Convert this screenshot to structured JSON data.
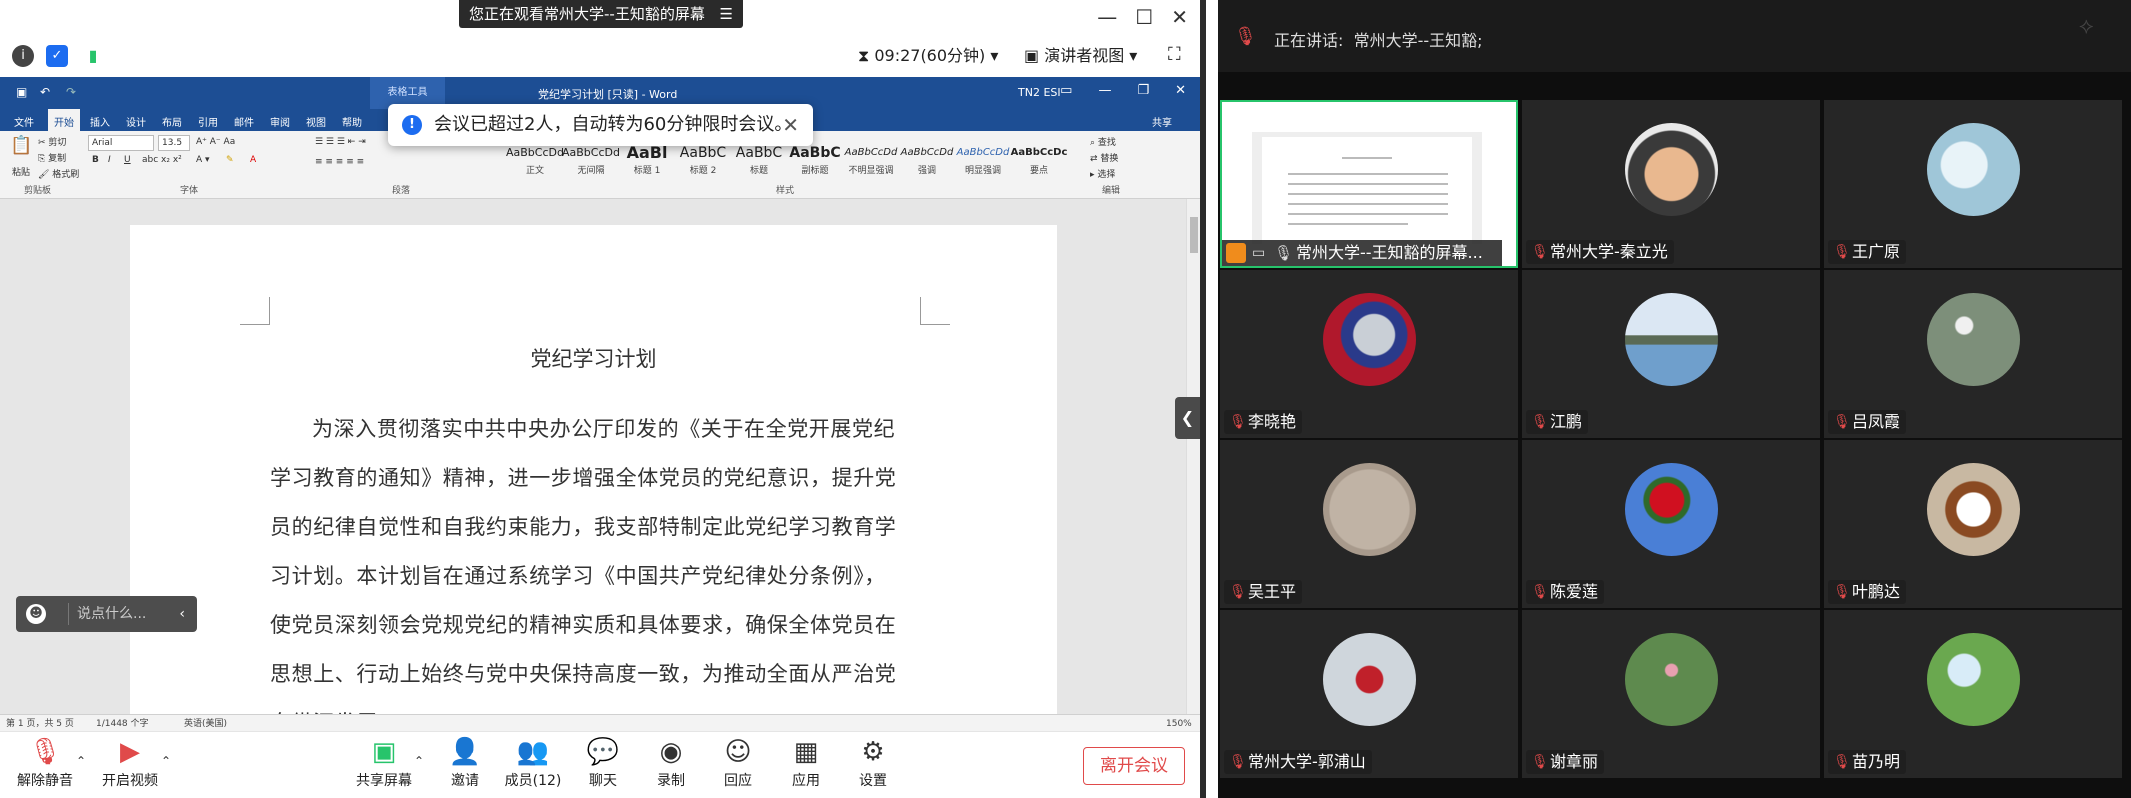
{
  "meeting": {
    "share_banner": "您正在观看常州大学--王知豁的屏幕",
    "timer": "09:27(60分钟)",
    "view_mode": "演讲者视图",
    "notice": "会议已超过2人，自动转为60分钟限时会议。",
    "chat_placeholder": "说点什么...",
    "leave_label": "离开会议",
    "toolbar": [
      {
        "key": "mute",
        "label": "解除静音",
        "icon": "mic-muted-icon"
      },
      {
        "key": "video",
        "label": "开启视频",
        "icon": "video-off-icon"
      },
      {
        "key": "share",
        "label": "共享屏幕",
        "icon": "share-screen-icon"
      },
      {
        "key": "invite",
        "label": "邀请",
        "icon": "invite-icon"
      },
      {
        "key": "members",
        "label": "成员(12)",
        "icon": "members-icon"
      },
      {
        "key": "chat",
        "label": "聊天",
        "icon": "chat-icon"
      },
      {
        "key": "record",
        "label": "录制",
        "icon": "record-icon"
      },
      {
        "key": "react",
        "label": "回应",
        "icon": "reaction-icon"
      },
      {
        "key": "apps",
        "label": "应用",
        "icon": "apps-icon"
      },
      {
        "key": "settings",
        "label": "设置",
        "icon": "settings-icon"
      }
    ]
  },
  "word": {
    "title": "党纪学习计划 [只读] - Word",
    "context_tab": "表格工具",
    "title_right": "TN2 ESI",
    "tabs": [
      "文件",
      "开始",
      "插入",
      "设计",
      "布局",
      "引用",
      "邮件",
      "审阅",
      "视图",
      "帮助"
    ],
    "share": "共享",
    "clipboard": {
      "paste": "粘贴",
      "cut": "剪切",
      "copy": "复制",
      "format_painter": "格式刷",
      "group": "剪贴板"
    },
    "font": {
      "name": "Arial",
      "size": "13.5",
      "group": "字体"
    },
    "paragraph_group": "段落",
    "styles": [
      {
        "preview": "AaBbCcDd",
        "name": "正文"
      },
      {
        "preview": "AaBbCcDd",
        "name": "无间隔"
      },
      {
        "preview": "AaBl",
        "name": "标题 1"
      },
      {
        "preview": "AaBbC",
        "name": "标题 2"
      },
      {
        "preview": "AaBbC",
        "name": "标题"
      },
      {
        "preview": "AaBbC",
        "name": "副标题"
      },
      {
        "preview": "AaBbCcDd",
        "name": "不明显强调"
      },
      {
        "preview": "AaBbCcDd",
        "name": "强调"
      },
      {
        "preview": "AaBbCcDd",
        "name": "明显强调"
      },
      {
        "preview": "AaBbCcDc",
        "name": "要点"
      }
    ],
    "styles_group": "样式",
    "editing": {
      "find": "查找",
      "replace": "替换",
      "select": "选择",
      "group": "编辑"
    },
    "doc_title": "党纪学习计划",
    "doc_body": "为深入贯彻落实中共中央办公厅印发的《关于在全党开展党纪学习教育的通知》精神，进一步增强全体党员的党纪意识，提升党员的纪律自觉性和自我约束能力，我支部特制定此党纪学习教育学习计划。本计划旨在通过系统学习《中国共产党纪律处分条例》，使党员深刻领会党规党纪的精神实质和具体要求，确保全体党员在思想上、行动上始终与党中央保持高度一致，为推动全面从严治党向纵深发展",
    "status": {
      "page": "第 1 页，共 5 页",
      "words": "1/1448 个字",
      "lang": "英语(美国)",
      "zoom": "150%"
    }
  },
  "gallery": {
    "speaking_label": "正在讲话:",
    "speaking_name": "常州大学--王知豁;",
    "share_tile_name": "常州大学--王知豁的屏幕...",
    "participants": [
      {
        "name": "常州大学-秦立光",
        "color": "#6b4a3a"
      },
      {
        "name": "王广原",
        "color": "#9fc6d8"
      },
      {
        "name": "李晓艳",
        "color": "#8a2033"
      },
      {
        "name": "江鹏",
        "color": "#6f9fcc"
      },
      {
        "name": "吕凤霞",
        "color": "#7d8f7a"
      },
      {
        "name": "吴王平",
        "color": "#a89a8c"
      },
      {
        "name": "陈爱莲",
        "color": "#4a7fd6"
      },
      {
        "name": "叶鹏达",
        "color": "#c8b8a2"
      },
      {
        "name": "常州大学-郭浦山",
        "color": "#cfd6dc"
      },
      {
        "name": "谢章丽",
        "color": "#5e8a4e"
      },
      {
        "name": "苗乃明",
        "color": "#6aa84f"
      }
    ]
  }
}
